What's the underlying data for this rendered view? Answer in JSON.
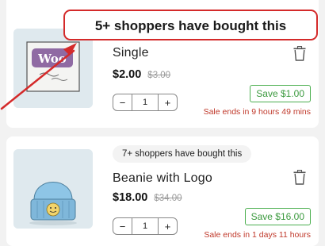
{
  "callout": {
    "text": "5+ shoppers have bought this"
  },
  "items": [
    {
      "badge": "",
      "title": "Single",
      "price": "$2.00",
      "old_price": "$3.00",
      "quantity": "1",
      "save": "Save $1.00",
      "sale_ends": "Sale ends in 9 hours 49 mins",
      "thumb_icon": "woo-album-art-icon",
      "thumb_text": "Woo"
    },
    {
      "badge": "7+ shoppers have bought this",
      "title": "Beanie with Logo",
      "price": "$18.00",
      "old_price": "$34.00",
      "quantity": "1",
      "save": "Save $16.00",
      "sale_ends": "Sale ends in 1 days 11 hours",
      "thumb_icon": "beanie-icon"
    }
  ],
  "controls": {
    "minus": "−",
    "plus": "+"
  },
  "colors": {
    "accent_red": "#d42a2a",
    "save_green": "#4caf50",
    "sale_red": "#c0392b"
  }
}
